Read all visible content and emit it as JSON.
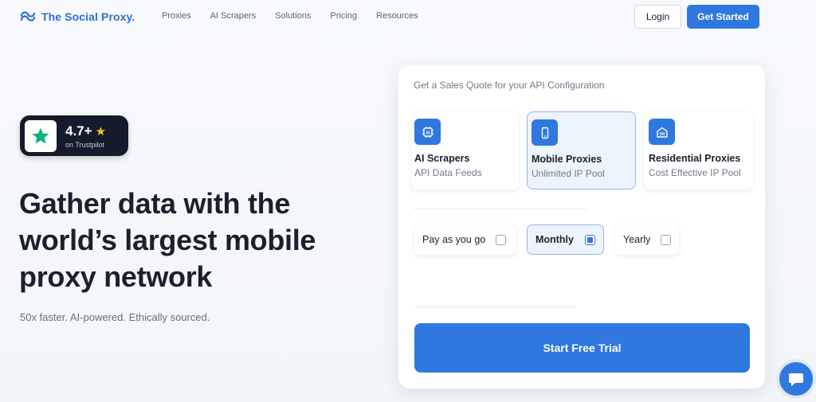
{
  "brand": {
    "name": "The Social Proxy."
  },
  "nav": {
    "links": [
      "Proxies",
      "AI Scrapers",
      "Solutions",
      "Pricing",
      "Resources"
    ],
    "login": "Login",
    "get_started": "Get Started"
  },
  "trustpilot": {
    "rating": "4.7+",
    "rating_star": "★",
    "source": "on Trustpilot"
  },
  "hero": {
    "title_line1": "Gather data with the",
    "title_line2": "world’s largest mobile",
    "title_line3": "proxy network",
    "subtitle": "50x faster. AI-powered. Ethically sourced."
  },
  "quote": {
    "heading": "Get a Sales Quote for your API Configuration",
    "products": [
      {
        "title": "AI Scrapers",
        "desc": "API Data Feeds",
        "icon": "chip-icon",
        "selected": false
      },
      {
        "title": "Mobile Proxies",
        "desc": "Unlimited IP Pool",
        "icon": "phone-icon",
        "selected": true
      },
      {
        "title": "Residential Proxies",
        "desc": "Cost Effective IP Pool",
        "icon": "house-icon",
        "selected": false
      }
    ],
    "billing": [
      {
        "label": "Pay as you go",
        "checked": false
      },
      {
        "label": "Monthly",
        "checked": true
      },
      {
        "label": "Yearly",
        "checked": false
      }
    ],
    "cta": "Start Free Trial"
  },
  "colors": {
    "accent": "#2f78e0",
    "dark": "#141c2b",
    "trustpilot_green": "#00b67a"
  }
}
